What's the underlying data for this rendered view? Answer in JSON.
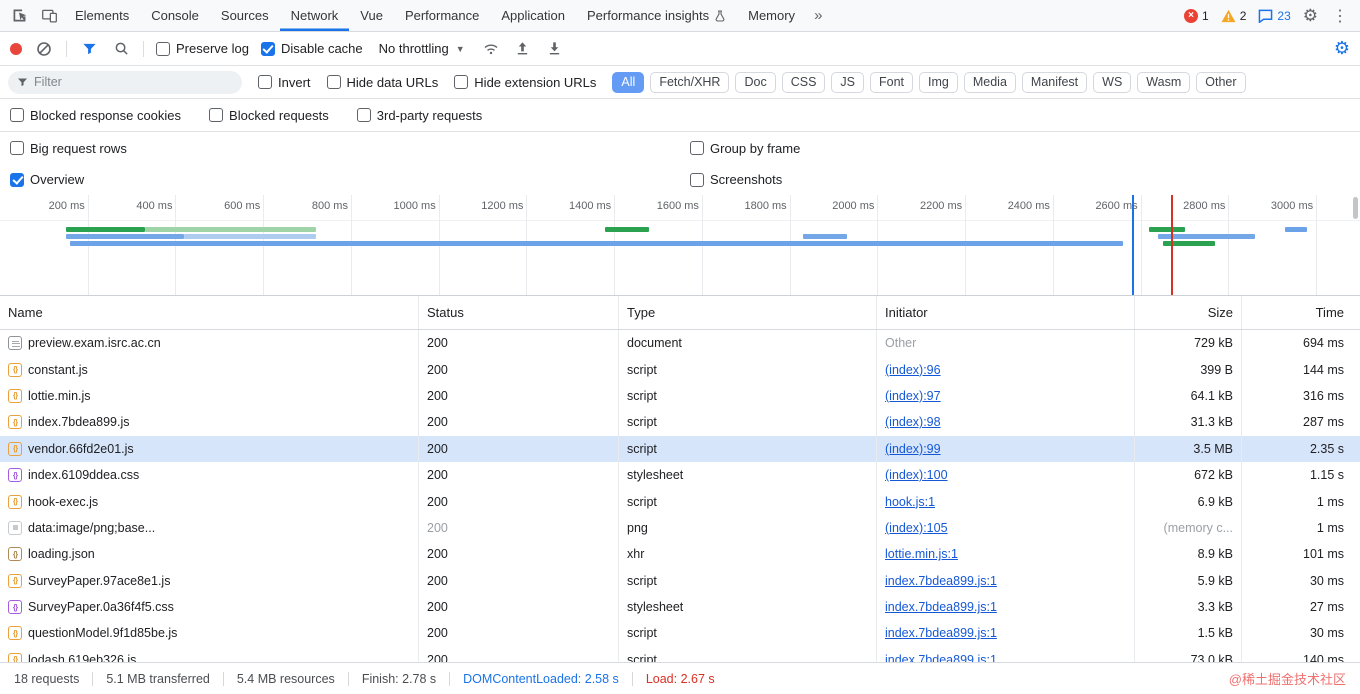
{
  "tabbar": {
    "tabs": [
      {
        "label": "Elements"
      },
      {
        "label": "Console"
      },
      {
        "label": "Sources"
      },
      {
        "label": "Network",
        "active": true
      },
      {
        "label": "Vue"
      },
      {
        "label": "Performance"
      },
      {
        "label": "Application"
      },
      {
        "label": "Performance insights",
        "icon": "experiment-icon"
      },
      {
        "label": "Memory"
      }
    ],
    "more_tabs": "»",
    "badges": {
      "errors": "1",
      "warnings": "2",
      "messages": "23"
    }
  },
  "toolbar": {
    "preserve_log": {
      "label": "Preserve log",
      "checked": false
    },
    "disable_cache": {
      "label": "Disable cache",
      "checked": true
    },
    "throttling": "No throttling"
  },
  "filterbar": {
    "placeholder": "Filter",
    "invert": {
      "label": "Invert",
      "checked": false
    },
    "hide_data_urls": {
      "label": "Hide data URLs",
      "checked": false
    },
    "hide_extension_urls": {
      "label": "Hide extension URLs",
      "checked": false
    },
    "chips": [
      {
        "label": "All",
        "selected": true
      },
      {
        "label": "Fetch/XHR"
      },
      {
        "label": "Doc"
      },
      {
        "label": "CSS"
      },
      {
        "label": "JS"
      },
      {
        "label": "Font"
      },
      {
        "label": "Img"
      },
      {
        "label": "Media"
      },
      {
        "label": "Manifest"
      },
      {
        "label": "WS"
      },
      {
        "label": "Wasm"
      },
      {
        "label": "Other"
      }
    ]
  },
  "options": {
    "blocked_response_cookies": {
      "label": "Blocked response cookies",
      "checked": false
    },
    "blocked_requests": {
      "label": "Blocked requests",
      "checked": false
    },
    "third_party_requests": {
      "label": "3rd-party requests",
      "checked": false
    },
    "big_request_rows": {
      "label": "Big request rows",
      "checked": false
    },
    "group_by_frame": {
      "label": "Group by frame",
      "checked": false
    },
    "overview": {
      "label": "Overview",
      "checked": true
    },
    "screenshots": {
      "label": "Screenshots",
      "checked": false
    }
  },
  "overview": {
    "range_ms": 3100,
    "ticks": [
      {
        "t": 200,
        "label": "200 ms"
      },
      {
        "t": 400,
        "label": "400 ms"
      },
      {
        "t": 600,
        "label": "600 ms"
      },
      {
        "t": 800,
        "label": "800 ms"
      },
      {
        "t": 1000,
        "label": "1000 ms"
      },
      {
        "t": 1200,
        "label": "1200 ms"
      },
      {
        "t": 1400,
        "label": "1400 ms"
      },
      {
        "t": 1600,
        "label": "1600 ms"
      },
      {
        "t": 1800,
        "label": "1800 ms"
      },
      {
        "t": 2000,
        "label": "2000 ms"
      },
      {
        "t": 2200,
        "label": "2200 ms"
      },
      {
        "t": 2400,
        "label": "2400 ms"
      },
      {
        "t": 2600,
        "label": "2600 ms"
      },
      {
        "t": 2800,
        "label": "2800 ms"
      },
      {
        "t": 3000,
        "label": "3000 ms"
      }
    ],
    "bars": [
      {
        "row": 0,
        "start": 150,
        "end": 330,
        "color": "#2ba24f"
      },
      {
        "row": 0,
        "start": 330,
        "end": 720,
        "color": "#9fd3a8"
      },
      {
        "row": 1,
        "start": 150,
        "end": 420,
        "color": "#74a7e8"
      },
      {
        "row": 1,
        "start": 420,
        "end": 720,
        "color": "#aecbf0"
      },
      {
        "row": 2,
        "start": 160,
        "end": 2560,
        "color": "#6ba2e8"
      },
      {
        "row": 0,
        "start": 1380,
        "end": 1480,
        "color": "#2ba24f"
      },
      {
        "row": 1,
        "start": 1830,
        "end": 1930,
        "color": "#74a7e8"
      },
      {
        "row": 0,
        "start": 2620,
        "end": 2700,
        "color": "#2ba24f"
      },
      {
        "row": 1,
        "start": 2640,
        "end": 2860,
        "color": "#74a7e8"
      },
      {
        "row": 2,
        "start": 2650,
        "end": 2770,
        "color": "#2ba24f"
      },
      {
        "row": 0,
        "start": 2930,
        "end": 2980,
        "color": "#6ba2e8"
      }
    ],
    "markers": [
      {
        "t": 2580,
        "color": "#1a73e8",
        "name": "domcontentloaded-marker"
      },
      {
        "t": 2670,
        "color": "#d93025",
        "name": "load-event-marker"
      }
    ]
  },
  "table": {
    "columns": [
      "Name",
      "Status",
      "Type",
      "Initiator",
      "Size",
      "Time"
    ],
    "rows": [
      {
        "name": "preview.exam.isrc.ac.cn",
        "icon": "document-icon",
        "status": "200",
        "type": "document",
        "initiator": "Other",
        "initiator_link": false,
        "size": "729 kB",
        "time": "694 ms"
      },
      {
        "name": "constant.js",
        "icon": "script-icon",
        "status": "200",
        "type": "script",
        "initiator": "(index):96",
        "initiator_link": true,
        "size": "399 B",
        "time": "144 ms"
      },
      {
        "name": "lottie.min.js",
        "icon": "script-icon",
        "status": "200",
        "type": "script",
        "initiator": "(index):97",
        "initiator_link": true,
        "size": "64.1 kB",
        "time": "316 ms"
      },
      {
        "name": "index.7bdea899.js",
        "icon": "script-icon",
        "status": "200",
        "type": "script",
        "initiator": "(index):98",
        "initiator_link": true,
        "size": "31.3 kB",
        "time": "287 ms"
      },
      {
        "name": "vendor.66fd2e01.js",
        "icon": "script-icon",
        "status": "200",
        "type": "script",
        "initiator": "(index):99",
        "initiator_link": true,
        "size": "3.5 MB",
        "time": "2.35 s",
        "selected": true
      },
      {
        "name": "index.6109ddea.css",
        "icon": "stylesheet-icon",
        "status": "200",
        "type": "stylesheet",
        "initiator": "(index):100",
        "initiator_link": true,
        "size": "672 kB",
        "time": "1.15 s"
      },
      {
        "name": "hook-exec.js",
        "icon": "script-icon",
        "status": "200",
        "type": "script",
        "initiator": "hook.js:1",
        "initiator_link": true,
        "size": "6.9 kB",
        "time": "1 ms"
      },
      {
        "name": "data:image/png;base...",
        "icon": "image-data-icon",
        "status": "200",
        "status_dim": true,
        "type": "png",
        "initiator": "(index):105",
        "initiator_link": true,
        "size": "(memory c...",
        "size_dim": true,
        "time": "1 ms"
      },
      {
        "name": "loading.json",
        "icon": "json-icon",
        "status": "200",
        "type": "xhr",
        "initiator": "lottie.min.js:1",
        "initiator_link": true,
        "size": "8.9 kB",
        "time": "101 ms"
      },
      {
        "name": "SurveyPaper.97ace8e1.js",
        "icon": "script-icon",
        "status": "200",
        "type": "script",
        "initiator": "index.7bdea899.js:1",
        "initiator_link": true,
        "size": "5.9 kB",
        "time": "30 ms"
      },
      {
        "name": "SurveyPaper.0a36f4f5.css",
        "icon": "stylesheet-icon",
        "status": "200",
        "type": "stylesheet",
        "initiator": "index.7bdea899.js:1",
        "initiator_link": true,
        "size": "3.3 kB",
        "time": "27 ms"
      },
      {
        "name": "questionModel.9f1d85be.js",
        "icon": "script-icon",
        "status": "200",
        "type": "script",
        "initiator": "index.7bdea899.js:1",
        "initiator_link": true,
        "size": "1.5 kB",
        "time": "30 ms"
      },
      {
        "name": "lodash.619eb326.js",
        "icon": "script-icon",
        "status": "200",
        "type": "script",
        "initiator": "index.7bdea899.js:1",
        "initiator_link": true,
        "size": "73.0 kB",
        "time": "140 ms"
      }
    ]
  },
  "statusbar": {
    "items": [
      {
        "text": "18 requests"
      },
      {
        "text": "5.1 MB transferred"
      },
      {
        "text": "5.4 MB resources"
      },
      {
        "text": "Finish: 2.78 s"
      },
      {
        "text": "DOMContentLoaded: 2.58 s",
        "color": "#1a73e8"
      },
      {
        "text": "Load: 2.67 s",
        "color": "#d93025"
      }
    ],
    "watermark": "@稀土掘金技术社区"
  }
}
